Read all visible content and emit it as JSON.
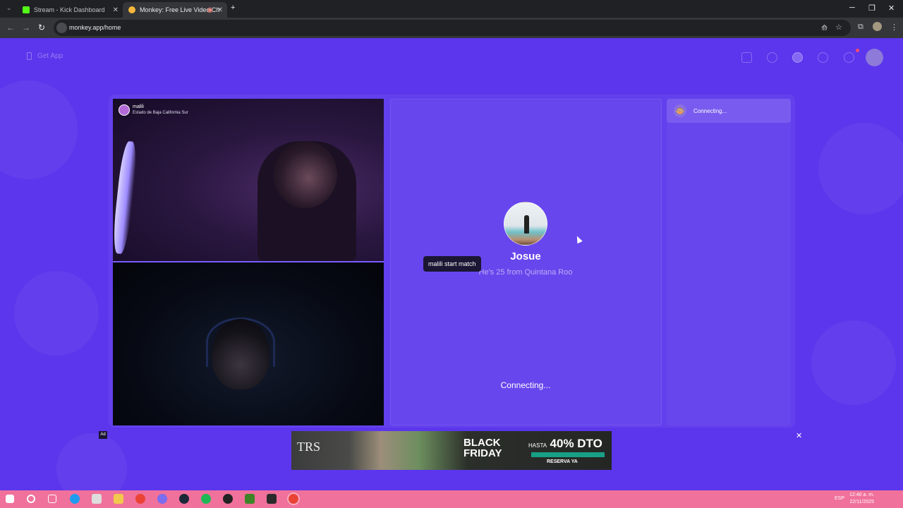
{
  "browser": {
    "tabs": [
      {
        "title": "Stream - Kick Dashboard",
        "active": false,
        "icon": "kick-icon",
        "color": "#53fc18"
      },
      {
        "title": "Monkey: Free Live Video Ch",
        "active": true,
        "icon": "monkey-icon",
        "color": "#f5b73b"
      }
    ],
    "new_tab": "+",
    "url": "monkey.app/home",
    "window_controls": {
      "minimize": "─",
      "maximize": "❐",
      "close": "✕"
    }
  },
  "page": {
    "get_app": "Get App",
    "background_color": "#5b36ec",
    "video": {
      "remote_name": "malili",
      "remote_location": "Estado de Baja California Sur"
    },
    "match": {
      "name": "Josue",
      "info": "He's 25 from Quintana Roo",
      "tooltip": "malili start match",
      "status": "Connecting..."
    },
    "side": {
      "status": "Connecting..."
    },
    "ad": {
      "label": "Ad",
      "close": "✕",
      "logo": "TRS",
      "headline": "BLACK FRIDAY",
      "discount_prefix": "HASTA",
      "discount": "40% DTO",
      "cta": "RESERVA YA"
    }
  },
  "taskbar": {
    "language": "ESP",
    "time": "12:40 a. m.",
    "date": "22/11/2025"
  }
}
